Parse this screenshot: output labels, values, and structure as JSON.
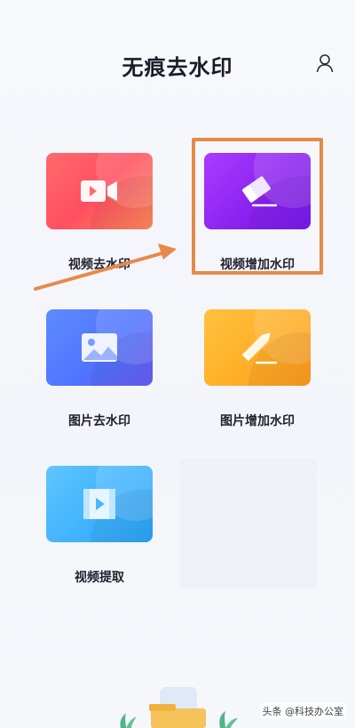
{
  "header": {
    "title": "无痕去水印",
    "user_icon": "person-icon"
  },
  "tiles": [
    {
      "label": "视频去水印",
      "icon": "video-camera-icon",
      "color": "#ff5a63"
    },
    {
      "label": "视频增加水印",
      "icon": "eraser-icon",
      "color": "#8b22f0"
    },
    {
      "label": "图片去水印",
      "icon": "image-icon",
      "color": "#4f74ff"
    },
    {
      "label": "图片增加水印",
      "icon": "pencil-icon",
      "color": "#ffae27"
    },
    {
      "label": "视频提取",
      "icon": "film-play-icon",
      "color": "#40b2ff"
    }
  ],
  "annotation": {
    "highlight_color": "#e58a49",
    "arrow_color": "#e58a49"
  },
  "watermark": "头条 @科技办公室"
}
